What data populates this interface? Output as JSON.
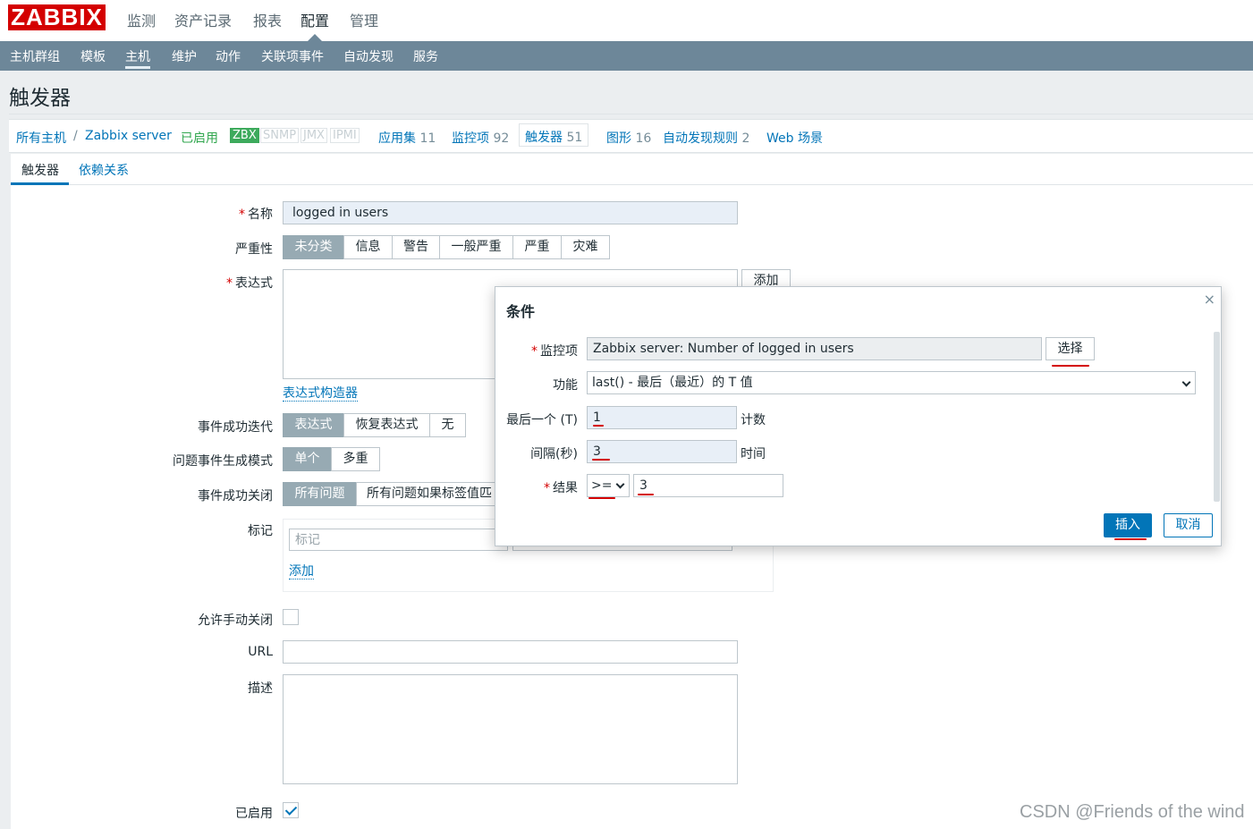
{
  "logo": "ZABBIX",
  "top_menu": [
    "监测",
    "资产记录",
    "报表",
    "配置",
    "管理"
  ],
  "top_menu_selected": "配置",
  "sub_menu": [
    "主机群组",
    "模板",
    "主机",
    "维护",
    "动作",
    "关联项事件",
    "自动发现",
    "服务"
  ],
  "sub_menu_selected": "主机",
  "page_title": "触发器",
  "breadcrumb": {
    "all_hosts": "所有主机",
    "separator": "/",
    "host": "Zabbix server",
    "status": "已启用",
    "availability": [
      "ZBX",
      "SNMP",
      "JMX",
      "IPMI"
    ],
    "items": [
      {
        "label": "应用集",
        "count": "11"
      },
      {
        "label": "监控项",
        "count": "92"
      },
      {
        "label": "触发器",
        "count": "51"
      },
      {
        "label": "图形",
        "count": "16"
      },
      {
        "label": "自动发现规则",
        "count": "2"
      },
      {
        "label": "Web 场景",
        "count": ""
      }
    ]
  },
  "tabs": [
    "触发器",
    "依赖关系"
  ],
  "form": {
    "name_label": "名称",
    "name_value": "logged in users",
    "severity_label": "严重性",
    "severity_options": [
      "未分类",
      "信息",
      "警告",
      "一般严重",
      "严重",
      "灾难"
    ],
    "expression_label": "表达式",
    "expression_add": "添加",
    "expression_builder": "表达式构造器",
    "ok_event_label": "事件成功迭代",
    "ok_event_options": [
      "表达式",
      "恢复表达式",
      "无"
    ],
    "problem_mode_label": "问题事件生成模式",
    "problem_mode_options": [
      "单个",
      "多重"
    ],
    "ok_close_label": "事件成功关闭",
    "ok_close_options": [
      "所有问题",
      "所有问题如果标签值匹配"
    ],
    "ok_close_visible": "所有问题如果标签值匹",
    "tags_label": "标记",
    "tag_placeholder": "标记",
    "tag_add": "添加",
    "manual_close_label": "允许手动关闭",
    "url_label": "URL",
    "description_label": "描述",
    "enabled_label": "已启用"
  },
  "dialog": {
    "title": "条件",
    "close": "×",
    "item_label": "监控项",
    "item_value": "Zabbix server: Number of logged in users",
    "select_button": "选择",
    "function_label": "功能",
    "function_value": "last() - 最后（最近）的 T 值",
    "last_label": "最后一个 (T)",
    "last_value": "1",
    "last_suffix": "计数",
    "interval_label": "间隔(秒)",
    "interval_value": "3",
    "interval_suffix": "时间",
    "result_label": "结果",
    "result_operator": ">=",
    "result_value": "3",
    "insert_button": "插入",
    "cancel_button": "取消"
  },
  "watermark": "CSDN @Friends of the wind",
  "colors": {
    "brand": "#d40000",
    "nav": "#6d8799",
    "link": "#0275b8",
    "segment_selected": "#97aab3",
    "enabled": "#2fa64d"
  }
}
